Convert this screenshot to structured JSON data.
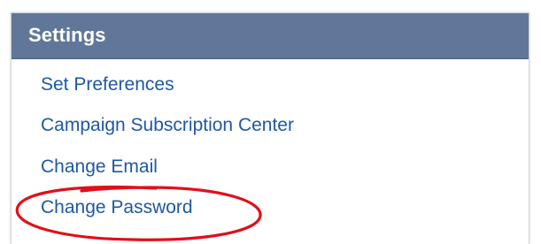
{
  "settings_panel": {
    "title": "Settings",
    "items": [
      {
        "label": "Set Preferences"
      },
      {
        "label": "Campaign Subscription Center"
      },
      {
        "label": "Change Email"
      },
      {
        "label": "Change Password"
      }
    ]
  },
  "colors": {
    "header_background": "#607799",
    "link": "#1f58a2",
    "highlight_circle": "#e0101a"
  },
  "annotation": {
    "type": "hand-drawn ellipse",
    "target": "Change Password"
  }
}
